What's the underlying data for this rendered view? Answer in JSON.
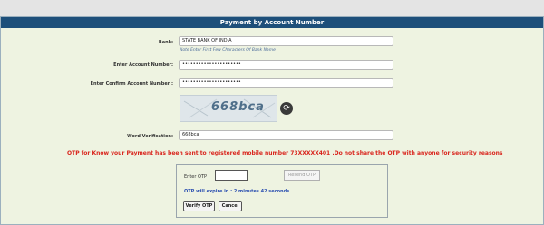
{
  "header": {
    "title": "Payment by Account Number"
  },
  "bank": {
    "label": "Bank:",
    "value": "STATE BANK OF INDIA",
    "note": "Note Enter First Few Characters Of Bank Name"
  },
  "account_number": {
    "label": "Enter Account Number:",
    "value": "••••••••••••••••••••••"
  },
  "confirm_account_number": {
    "label": "Enter Confirm Account Number :",
    "value": "••••••••••••••••••••••"
  },
  "captcha": {
    "text": "668bca",
    "refresh_icon": "refresh-icon"
  },
  "word_verification": {
    "label": "Word Verification:",
    "value": "668bca"
  },
  "otp_message": "OTP for Know your Payment has been sent to registered mobile number 73XXXXX401 .Do not share the OTP with anyone for security reasons",
  "otp": {
    "label": "Enter OTP :",
    "value": "",
    "resend_label": "Resend OTP",
    "expiry_text": "OTP will expire in : 2 minutes 42 seconds",
    "verify_label": "Verify OTP",
    "cancel_label": "Cancel"
  },
  "colors": {
    "header_bg": "#1d4f7a",
    "panel_bg": "#eef3e1",
    "warning": "#d9251d",
    "info": "#2b4fb0"
  }
}
